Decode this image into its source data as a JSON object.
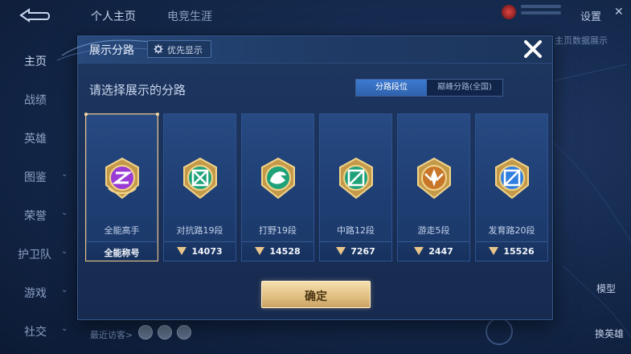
{
  "top_tabs": [
    {
      "label": "个人主页",
      "active": true
    },
    {
      "label": "电竞生涯",
      "active": false
    }
  ],
  "topbar": {
    "settings_label": "设置",
    "close_icon": "close-icon"
  },
  "side_nav": [
    {
      "label": "主页",
      "active": true,
      "chevron": false
    },
    {
      "label": "战绩",
      "active": false,
      "chevron": false
    },
    {
      "label": "英雄",
      "active": false,
      "chevron": false
    },
    {
      "label": "图鉴",
      "active": false,
      "chevron": true
    },
    {
      "label": "荣誉",
      "active": false,
      "chevron": true
    },
    {
      "label": "护卫队",
      "active": false,
      "chevron": true
    },
    {
      "label": "游戏",
      "active": false,
      "chevron": true
    },
    {
      "label": "社交",
      "active": false,
      "chevron": true
    }
  ],
  "bottom": {
    "recent_visitors": "最近访客>",
    "model_label": "模型",
    "swap_label": "换英雄"
  },
  "right_tag": "主页数据展示",
  "modal": {
    "title": "展示分路",
    "priority_label": "优先显示",
    "prompt": "请选择展示的分路",
    "segments": [
      {
        "label": "分路段位",
        "active": true
      },
      {
        "label": "巅峰分路(全国)",
        "active": false
      }
    ],
    "cards": [
      {
        "name": "全能高手",
        "score": "全能称号",
        "selected": true,
        "emblem": "allround-emblem",
        "color": "#9a3bd6"
      },
      {
        "name": "对抗路19段",
        "score": "14073",
        "selected": false,
        "emblem": "clash-lane-emblem",
        "color": "#1fa27a"
      },
      {
        "name": "打野19段",
        "score": "14528",
        "selected": false,
        "emblem": "jungle-emblem",
        "color": "#1fa27a"
      },
      {
        "name": "中路12段",
        "score": "7267",
        "selected": false,
        "emblem": "mid-lane-emblem",
        "color": "#1fa27a"
      },
      {
        "name": "游走5段",
        "score": "2447",
        "selected": false,
        "emblem": "roam-emblem",
        "color": "#c8772a"
      },
      {
        "name": "发育路20段",
        "score": "15526",
        "selected": false,
        "emblem": "farm-lane-emblem",
        "color": "#2f7fe0"
      }
    ],
    "confirm_label": "确定"
  }
}
